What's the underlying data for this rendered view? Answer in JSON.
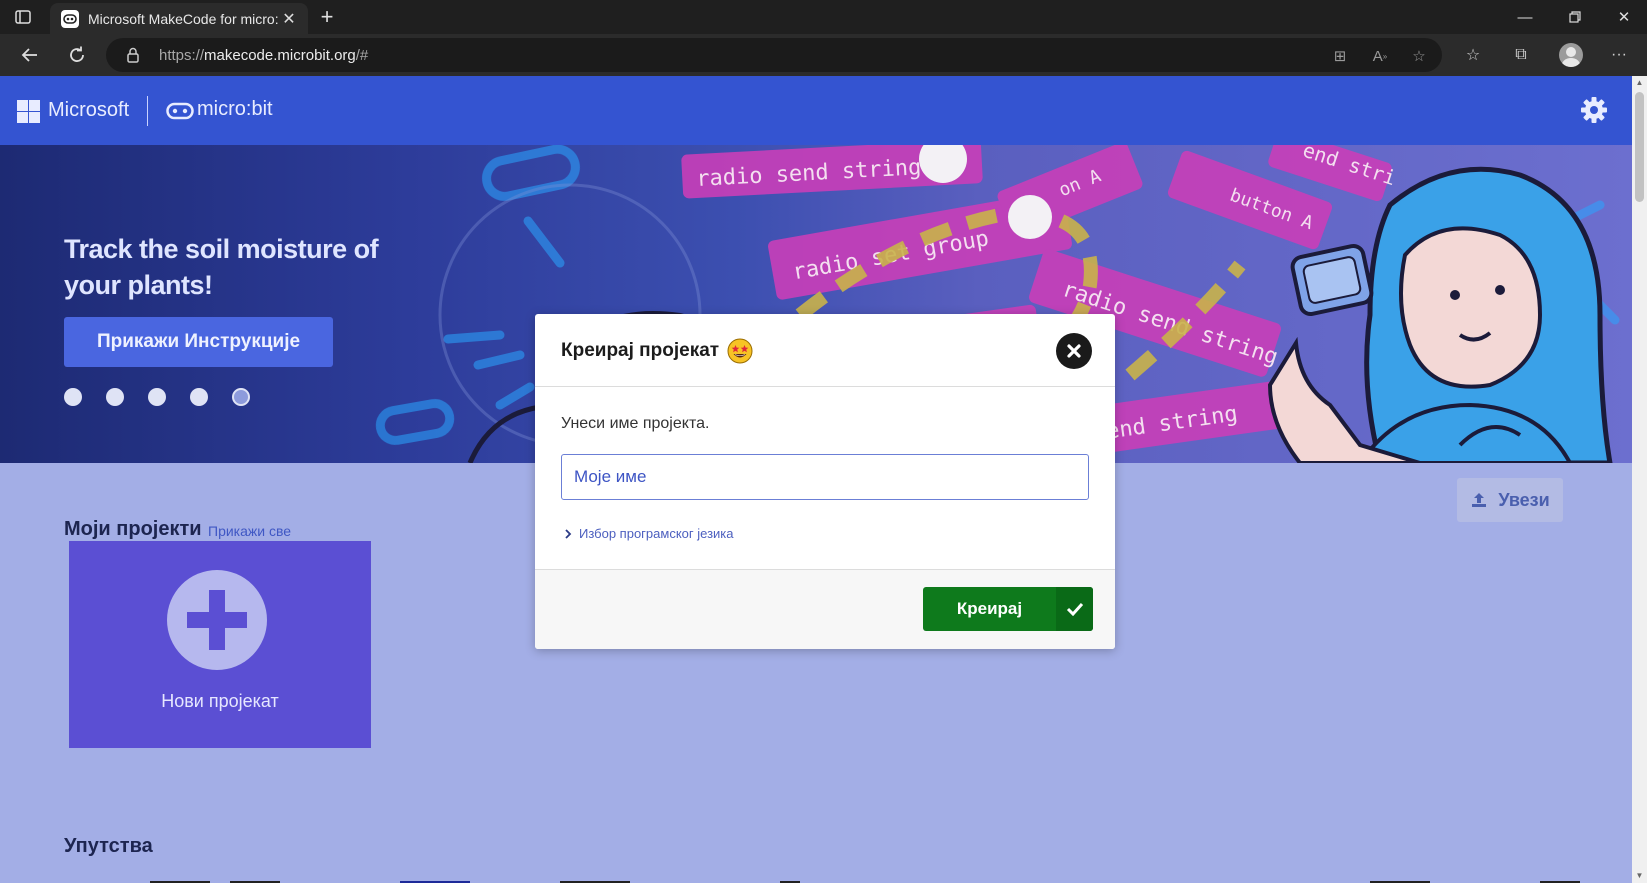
{
  "browser": {
    "tab_title": "Microsoft MakeCode for micro:bit",
    "url_prefix": "https://",
    "url_host": "makecode.microbit.org",
    "url_suffix": "/#"
  },
  "header": {
    "microsoft_label": "Microsoft",
    "microbit_label": "micro:bit"
  },
  "hero": {
    "title": "Track the soil moisture of your plants!",
    "button_label": "Прикажи Инструкције",
    "slide_count": 5,
    "active_slide": 5,
    "art_text": [
      "radio send string",
      "radio set group",
      "on A",
      "button A",
      "send string",
      "radio send string",
      "end string"
    ]
  },
  "projects": {
    "title": "Моји пројекти",
    "show_all": "Прикажи све",
    "import_label": "Увези",
    "new_project_label": "Нови пројекат"
  },
  "tutorials": {
    "title": "Упутства"
  },
  "modal": {
    "title": "Креирај пројекат",
    "prompt": "Унеси име пројекта.",
    "input_value": "Моје име",
    "language_toggle": "Избор програмског језика",
    "create_label": "Креирај"
  },
  "colors": {
    "header_blue": "#3454d1",
    "page_background": "#a3aee6",
    "create_green": "#0e7a1c",
    "new_project_purple": "#5b4fd3"
  }
}
